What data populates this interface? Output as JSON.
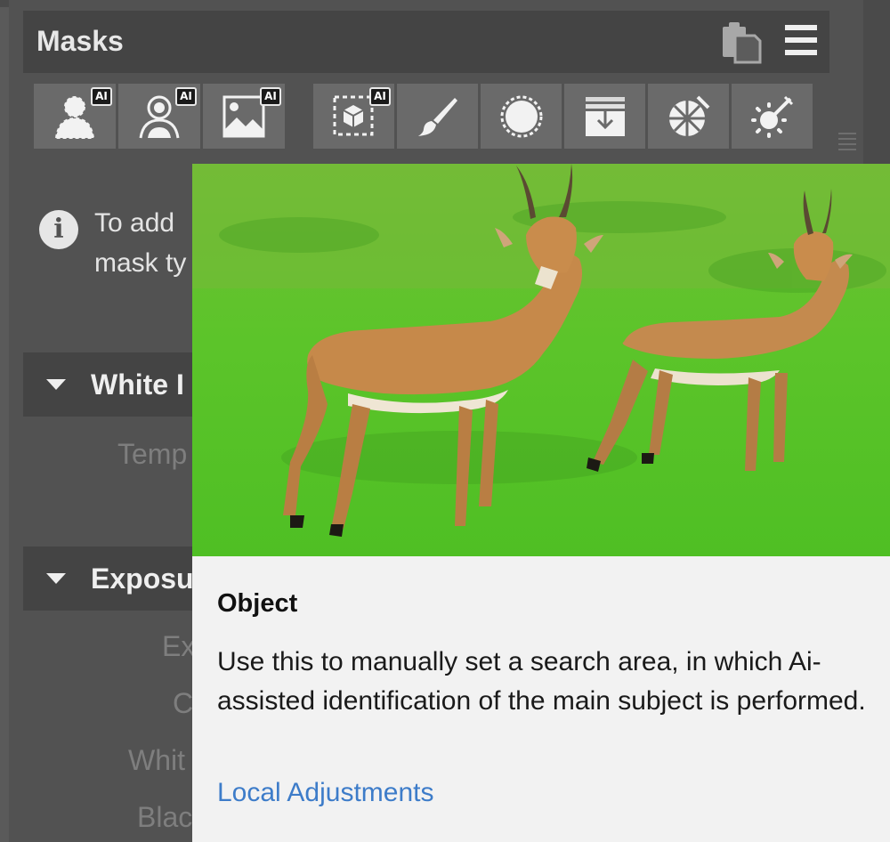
{
  "panel": {
    "title": "Masks",
    "header_icons": [
      "clipboard-icon",
      "hamburger-menu-icon"
    ]
  },
  "toolbar": {
    "ai_badge": "AI",
    "group1": [
      {
        "name": "person-mask-ai",
        "icon": "person-icon",
        "ai": true
      },
      {
        "name": "portrait-mask-ai",
        "icon": "portrait-icon",
        "ai": true
      },
      {
        "name": "sky-mask-ai",
        "icon": "landscape-icon",
        "ai": true
      }
    ],
    "group2": [
      {
        "name": "object-mask-ai",
        "icon": "object-selection-icon",
        "ai": true
      },
      {
        "name": "brush-mask",
        "icon": "brush-icon",
        "ai": false
      },
      {
        "name": "radial-mask",
        "icon": "radial-icon",
        "ai": false
      },
      {
        "name": "gradient-mask",
        "icon": "gradient-icon",
        "ai": false
      },
      {
        "name": "color-mask",
        "icon": "color-wheel-icon",
        "ai": false
      },
      {
        "name": "luminance-mask",
        "icon": "magic-wand-icon",
        "ai": false
      }
    ]
  },
  "info": {
    "line1": "To add",
    "line2": "mask ty"
  },
  "sections": {
    "white_balance": {
      "title": "White I",
      "params": [
        "Temp"
      ]
    },
    "exposure": {
      "title": "Exposu",
      "params": [
        "Ex",
        "C",
        "Whit",
        "Blac"
      ]
    }
  },
  "tooltip": {
    "title": "Object",
    "description": "Use this to manually set a search area, in which Ai-assisted identification of the main subject is performed.",
    "link": "Local Adjustments"
  },
  "colors": {
    "panel_bg": "#525252",
    "header_bg": "#444444",
    "tool_bg": "#6a6a6a",
    "tooltip_bg": "#f2f2f2",
    "link": "#3d7cc9"
  }
}
